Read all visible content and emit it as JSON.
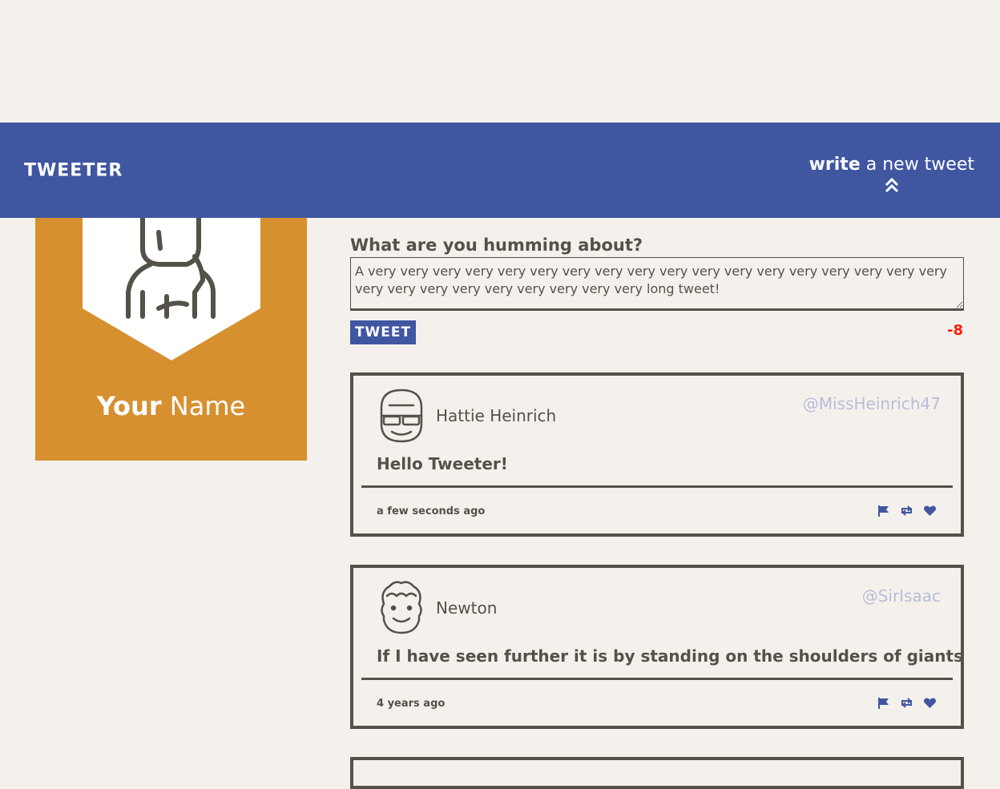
{
  "nav": {
    "brand": "TWEETER",
    "compose_bold": "write",
    "compose_rest": " a new tweet"
  },
  "profile": {
    "first_name": "Your",
    "last_name": " Name"
  },
  "composer": {
    "label": "What are you humming about?",
    "value": "A very very very very very very very very very very very very very very very very very very very very very very very very very very very long tweet!",
    "button_label": "TWEET",
    "counter": "-8"
  },
  "tweets": [
    {
      "name": "Hattie Heinrich",
      "handle": "@MissHeinrich47",
      "content": "Hello Tweeter!",
      "time": "a few seconds ago"
    },
    {
      "name": "Newton",
      "handle": "@SirIsaac",
      "content": "If I have seen further it is by standing on the shoulders of giants",
      "time": "4 years ago"
    }
  ],
  "colors": {
    "accent": "#4056a1",
    "card": "#d6902f",
    "background": "#f4f1ec",
    "text": "#545149",
    "counter_error": "#ff1b0a",
    "handle": "#b9bdd9"
  }
}
